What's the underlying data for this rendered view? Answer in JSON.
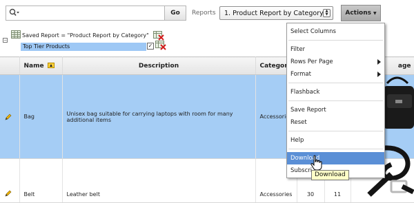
{
  "toolbar": {
    "search_value": "",
    "search_icon": "magnifier-dropdown-icon",
    "go_label": "Go",
    "reports_label": "Reports",
    "report_selected": "1. Product Report by Category",
    "actions_label": "Actions"
  },
  "saved_report": {
    "label": "Saved Report = \"Product Report by Category\"",
    "filter_label": "Top Tier Products",
    "filter_checked": true
  },
  "table": {
    "columns": [
      "Name",
      "Description",
      "Category",
      "",
      "",
      "age"
    ],
    "rows": [
      {
        "name": "Bag",
        "description": "Unisex bag suitable for carrying laptops with room for many additional items",
        "category": "Accessories",
        "col4": "",
        "col5": ""
      },
      {
        "name": "Belt",
        "description": "Leather belt",
        "category": "Accessories",
        "col4": "30",
        "col5": "11"
      }
    ]
  },
  "actions_menu": {
    "items": [
      {
        "label": "Select Columns",
        "has_submenu": false
      },
      {
        "label": "Filter",
        "has_submenu": false
      },
      {
        "label": "Rows Per Page",
        "has_submenu": true
      },
      {
        "label": "Format",
        "has_submenu": true
      },
      {
        "label": "Flashback",
        "has_submenu": false
      },
      {
        "label": "Save Report",
        "has_submenu": false
      },
      {
        "label": "Reset",
        "has_submenu": false
      },
      {
        "label": "Help",
        "has_submenu": false
      },
      {
        "label": "Download",
        "has_submenu": false
      },
      {
        "label": "Subscri",
        "has_submenu": false
      }
    ],
    "highlighted": "Download"
  },
  "tooltip": "Download",
  "colors": {
    "selected_row": "#a5cdf5",
    "menu_highlight": "#5a8fd6",
    "filter_bar": "#9ec8f5"
  }
}
